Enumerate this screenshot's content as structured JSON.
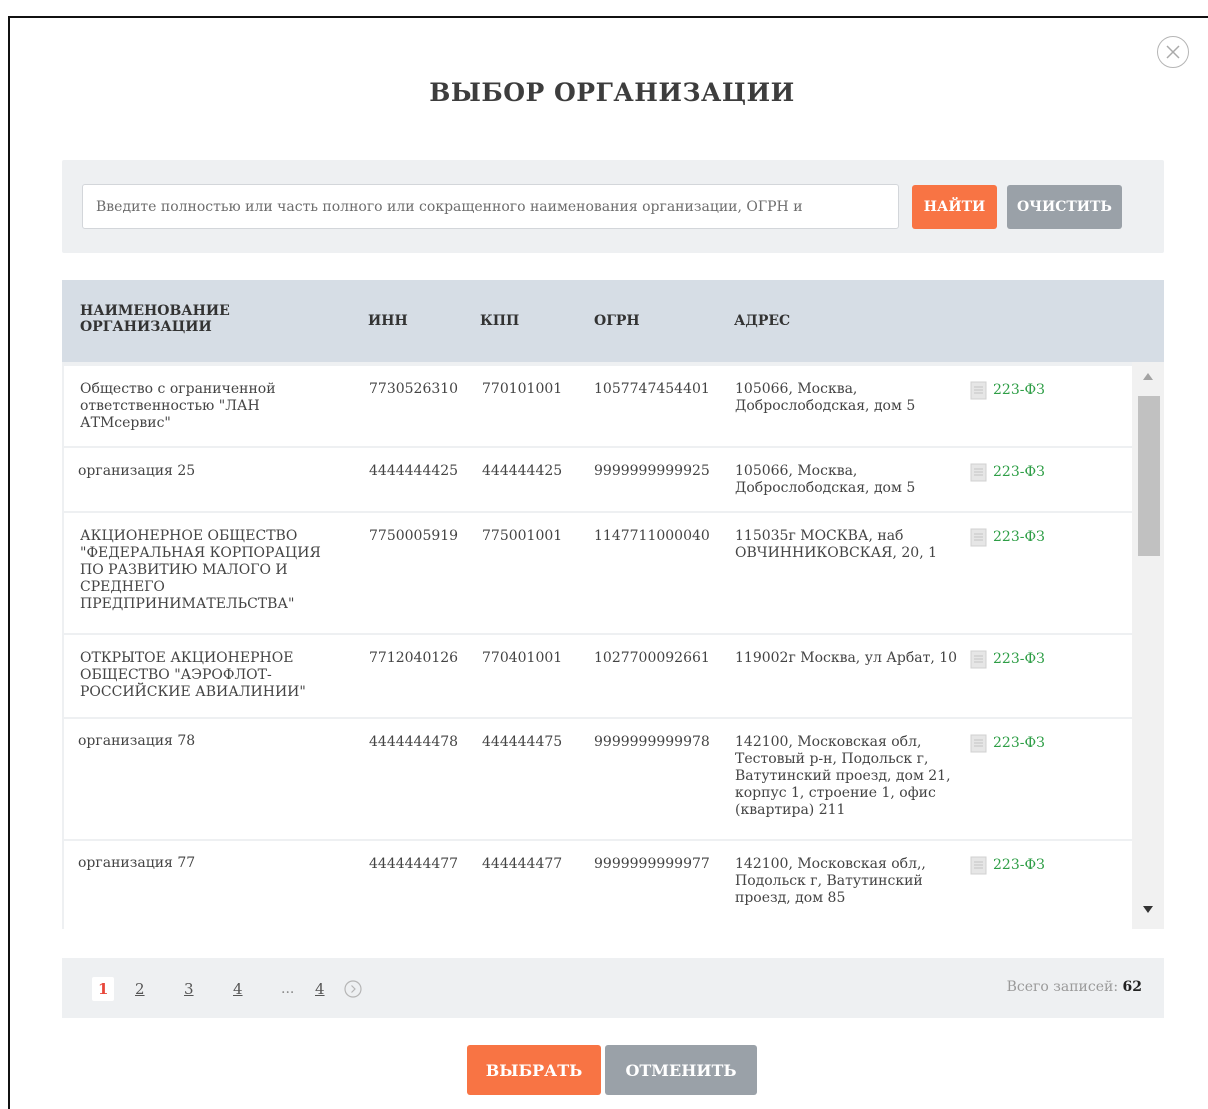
{
  "dialog": {
    "title": "ВЫБОР ОРГАНИЗАЦИИ"
  },
  "search": {
    "placeholder": "Введите полностью или часть полного или сокращенного наименования организации, ОГРН и",
    "find_label": "НАЙТИ",
    "clear_label": "ОЧИСТИТЬ"
  },
  "table": {
    "headers": {
      "name": "НАИМЕНОВАНИЕ ОРГАНИЗАЦИИ",
      "inn": "ИНН",
      "kpp": "КПП",
      "ogrn": "ОГРН",
      "address": "АДРЕС"
    },
    "rows": [
      {
        "name": "Общество с ограниченной ответственностью \"ЛАН АТМсервис\"",
        "inn": "7730526310",
        "kpp": "770101001",
        "ogrn": "1057747454401",
        "address": "105066, Москва, Доброслободская, дом 5",
        "law": "223-ФЗ"
      },
      {
        "name": "организация 25",
        "inn": "4444444425",
        "kpp": "444444425",
        "ogrn": "9999999999925",
        "address": "105066, Москва, Доброслободская, дом 5",
        "law": "223-ФЗ"
      },
      {
        "name": "АКЦИОНЕРНОЕ ОБЩЕСТВО \"ФЕДЕРАЛЬНАЯ КОРПОРАЦИЯ ПО РАЗВИТИЮ МАЛОГО И СРЕДНЕГО ПРЕДПРИНИМАТЕЛЬСТВА\"",
        "inn": "7750005919",
        "kpp": "775001001",
        "ogrn": "1147711000040",
        "address": "115035г МОСКВА, наб ОВЧИННИКОВСКАЯ, 20, 1",
        "law": "223-ФЗ"
      },
      {
        "name": "ОТКРЫТОЕ АКЦИОНЕРНОЕ ОБЩЕСТВО \"АЭРОФЛОТ-РОССИЙСКИЕ АВИАЛИНИИ\"",
        "inn": "7712040126",
        "kpp": "770401001",
        "ogrn": "1027700092661",
        "address": "119002г Москва, ул Арбат, 10",
        "law": "223-ФЗ"
      },
      {
        "name": "организация 78",
        "inn": "4444444478",
        "kpp": "444444475",
        "ogrn": "9999999999978",
        "address": "142100, Московская обл, Тестовый р-н, Подольск г, Ватутинский проезд, дом 21, корпус 1, строение 1, офис (квартира) 211",
        "law": "223-ФЗ"
      },
      {
        "name": "организация 77",
        "inn": "4444444477",
        "kpp": "444444477",
        "ogrn": "9999999999977",
        "address": "142100, Московская обл,, Подольск г, Ватутинский проезд, дом 85",
        "law": "223-ФЗ"
      }
    ]
  },
  "pagination": {
    "pages": [
      "1",
      "2",
      "3",
      "4"
    ],
    "ellipsis": "...",
    "last_page": "4",
    "total_label": "Всего записей:",
    "total_count": "62"
  },
  "footer": {
    "select_label": "ВЫБРАТЬ",
    "cancel_label": "ОТМЕНИТЬ"
  },
  "colors": {
    "accent": "#f87444",
    "secondary": "#9aa1a8",
    "link_green": "#2e9e46",
    "header_bg": "#d6dde5"
  },
  "icons": {
    "close": "close-circle-icon",
    "document": "document-icon",
    "next_page": "chevron-right-circle-icon"
  }
}
